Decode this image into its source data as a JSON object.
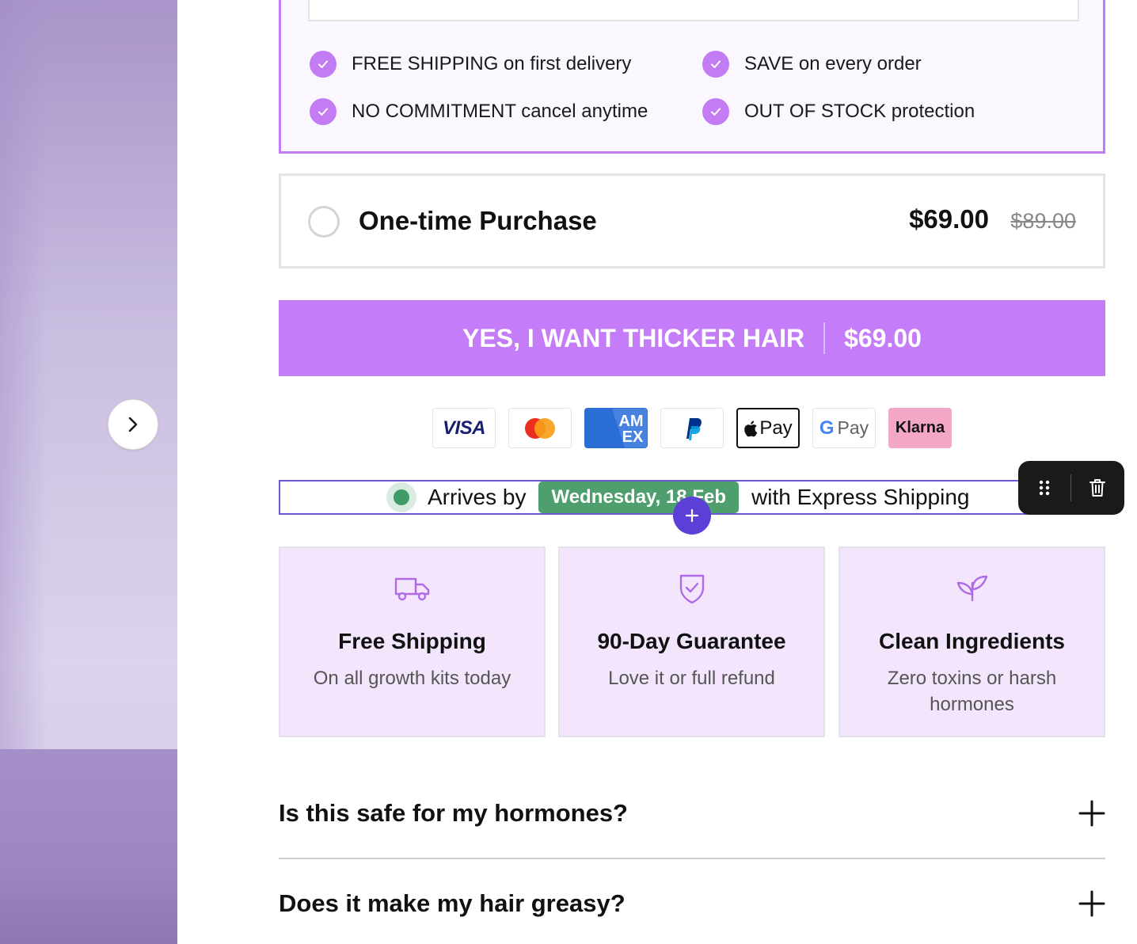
{
  "subscribe": {
    "benefits": [
      "FREE SHIPPING on first delivery",
      "SAVE on every order",
      "NO COMMITMENT cancel anytime",
      "OUT OF STOCK protection"
    ]
  },
  "one_time": {
    "label": "One-time Purchase",
    "price": "$69.00",
    "old_price": "$89.00"
  },
  "cta": {
    "label": "YES, I WANT THICKER HAIR",
    "price": "$69.00",
    "color": "#c47cf8"
  },
  "payments": [
    "VISA",
    "Mastercard",
    "AMEX",
    "PayPal",
    "Pay",
    "Pay",
    "Klarna"
  ],
  "delivery": {
    "prefix": "Arrives by",
    "date": "Wednesday, 18 Feb",
    "suffix": "with Express Shipping"
  },
  "features": [
    {
      "icon": "truck-icon",
      "title": "Free Shipping",
      "text": "On all growth kits today"
    },
    {
      "icon": "shield-check-icon",
      "title": "90-Day Guarantee",
      "text": "Love it or full refund"
    },
    {
      "icon": "leaf-icon",
      "title": "Clean Ingredients",
      "text": "Zero toxins or harsh hormones"
    }
  ],
  "faq": [
    "Is this safe for my hormones?",
    "Does it make my hair greasy?"
  ]
}
